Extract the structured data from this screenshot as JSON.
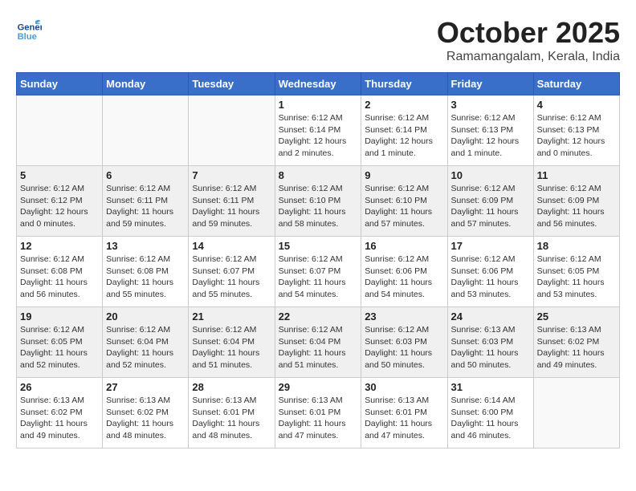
{
  "header": {
    "logo_general": "General",
    "logo_blue": "Blue",
    "month_title": "October 2025",
    "subtitle": "Ramamangalam, Kerala, India"
  },
  "weekdays": [
    "Sunday",
    "Monday",
    "Tuesday",
    "Wednesday",
    "Thursday",
    "Friday",
    "Saturday"
  ],
  "weeks": [
    [
      {
        "day": "",
        "info": ""
      },
      {
        "day": "",
        "info": ""
      },
      {
        "day": "",
        "info": ""
      },
      {
        "day": "1",
        "info": "Sunrise: 6:12 AM\nSunset: 6:14 PM\nDaylight: 12 hours\nand 2 minutes."
      },
      {
        "day": "2",
        "info": "Sunrise: 6:12 AM\nSunset: 6:14 PM\nDaylight: 12 hours\nand 1 minute."
      },
      {
        "day": "3",
        "info": "Sunrise: 6:12 AM\nSunset: 6:13 PM\nDaylight: 12 hours\nand 1 minute."
      },
      {
        "day": "4",
        "info": "Sunrise: 6:12 AM\nSunset: 6:13 PM\nDaylight: 12 hours\nand 0 minutes."
      }
    ],
    [
      {
        "day": "5",
        "info": "Sunrise: 6:12 AM\nSunset: 6:12 PM\nDaylight: 12 hours\nand 0 minutes."
      },
      {
        "day": "6",
        "info": "Sunrise: 6:12 AM\nSunset: 6:11 PM\nDaylight: 11 hours\nand 59 minutes."
      },
      {
        "day": "7",
        "info": "Sunrise: 6:12 AM\nSunset: 6:11 PM\nDaylight: 11 hours\nand 59 minutes."
      },
      {
        "day": "8",
        "info": "Sunrise: 6:12 AM\nSunset: 6:10 PM\nDaylight: 11 hours\nand 58 minutes."
      },
      {
        "day": "9",
        "info": "Sunrise: 6:12 AM\nSunset: 6:10 PM\nDaylight: 11 hours\nand 57 minutes."
      },
      {
        "day": "10",
        "info": "Sunrise: 6:12 AM\nSunset: 6:09 PM\nDaylight: 11 hours\nand 57 minutes."
      },
      {
        "day": "11",
        "info": "Sunrise: 6:12 AM\nSunset: 6:09 PM\nDaylight: 11 hours\nand 56 minutes."
      }
    ],
    [
      {
        "day": "12",
        "info": "Sunrise: 6:12 AM\nSunset: 6:08 PM\nDaylight: 11 hours\nand 56 minutes."
      },
      {
        "day": "13",
        "info": "Sunrise: 6:12 AM\nSunset: 6:08 PM\nDaylight: 11 hours\nand 55 minutes."
      },
      {
        "day": "14",
        "info": "Sunrise: 6:12 AM\nSunset: 6:07 PM\nDaylight: 11 hours\nand 55 minutes."
      },
      {
        "day": "15",
        "info": "Sunrise: 6:12 AM\nSunset: 6:07 PM\nDaylight: 11 hours\nand 54 minutes."
      },
      {
        "day": "16",
        "info": "Sunrise: 6:12 AM\nSunset: 6:06 PM\nDaylight: 11 hours\nand 54 minutes."
      },
      {
        "day": "17",
        "info": "Sunrise: 6:12 AM\nSunset: 6:06 PM\nDaylight: 11 hours\nand 53 minutes."
      },
      {
        "day": "18",
        "info": "Sunrise: 6:12 AM\nSunset: 6:05 PM\nDaylight: 11 hours\nand 53 minutes."
      }
    ],
    [
      {
        "day": "19",
        "info": "Sunrise: 6:12 AM\nSunset: 6:05 PM\nDaylight: 11 hours\nand 52 minutes."
      },
      {
        "day": "20",
        "info": "Sunrise: 6:12 AM\nSunset: 6:04 PM\nDaylight: 11 hours\nand 52 minutes."
      },
      {
        "day": "21",
        "info": "Sunrise: 6:12 AM\nSunset: 6:04 PM\nDaylight: 11 hours\nand 51 minutes."
      },
      {
        "day": "22",
        "info": "Sunrise: 6:12 AM\nSunset: 6:04 PM\nDaylight: 11 hours\nand 51 minutes."
      },
      {
        "day": "23",
        "info": "Sunrise: 6:12 AM\nSunset: 6:03 PM\nDaylight: 11 hours\nand 50 minutes."
      },
      {
        "day": "24",
        "info": "Sunrise: 6:13 AM\nSunset: 6:03 PM\nDaylight: 11 hours\nand 50 minutes."
      },
      {
        "day": "25",
        "info": "Sunrise: 6:13 AM\nSunset: 6:02 PM\nDaylight: 11 hours\nand 49 minutes."
      }
    ],
    [
      {
        "day": "26",
        "info": "Sunrise: 6:13 AM\nSunset: 6:02 PM\nDaylight: 11 hours\nand 49 minutes."
      },
      {
        "day": "27",
        "info": "Sunrise: 6:13 AM\nSunset: 6:02 PM\nDaylight: 11 hours\nand 48 minutes."
      },
      {
        "day": "28",
        "info": "Sunrise: 6:13 AM\nSunset: 6:01 PM\nDaylight: 11 hours\nand 48 minutes."
      },
      {
        "day": "29",
        "info": "Sunrise: 6:13 AM\nSunset: 6:01 PM\nDaylight: 11 hours\nand 47 minutes."
      },
      {
        "day": "30",
        "info": "Sunrise: 6:13 AM\nSunset: 6:01 PM\nDaylight: 11 hours\nand 47 minutes."
      },
      {
        "day": "31",
        "info": "Sunrise: 6:14 AM\nSunset: 6:00 PM\nDaylight: 11 hours\nand 46 minutes."
      },
      {
        "day": "",
        "info": ""
      }
    ]
  ]
}
